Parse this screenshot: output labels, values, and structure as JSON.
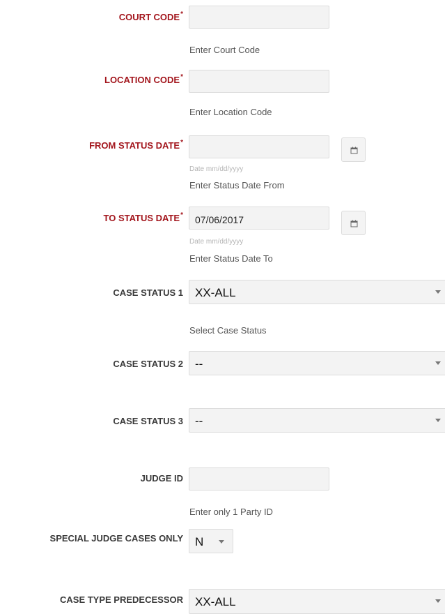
{
  "fields": {
    "court_code": {
      "label": "COURT CODE",
      "required_mark": "*",
      "value": "",
      "help": "Enter Court Code"
    },
    "location_code": {
      "label": "LOCATION CODE",
      "required_mark": "*",
      "value": "",
      "help": "Enter Location Code"
    },
    "from_status_date": {
      "label": "FROM STATUS DATE",
      "required_mark": "*",
      "value": "",
      "hint": "Date mm/dd/yyyy",
      "help": "Enter Status Date From",
      "icon": "calendar-icon"
    },
    "to_status_date": {
      "label": "TO STATUS DATE",
      "required_mark": "*",
      "value": "07/06/2017",
      "hint": "Date mm/dd/yyyy",
      "help": "Enter Status Date To",
      "icon": "calendar-icon"
    },
    "case_status_1": {
      "label": "CASE STATUS 1",
      "value": "XX-ALL",
      "help": "Select Case Status"
    },
    "case_status_2": {
      "label": "CASE STATUS 2",
      "value": "--"
    },
    "case_status_3": {
      "label": "CASE STATUS 3",
      "value": "--"
    },
    "judge_id": {
      "label": "JUDGE ID",
      "value": "",
      "help": "Enter only 1 Party ID"
    },
    "special_judge_cases_only": {
      "label": "SPECIAL JUDGE CASES ONLY",
      "value": "N"
    },
    "case_type_predecessor": {
      "label": "CASE TYPE PREDECESSOR",
      "value": "XX-ALL"
    }
  },
  "colors": {
    "required_label": "#a3161d",
    "label": "#3a3a3a",
    "field_bg": "#f3f3f3",
    "border": "#dcdcdc"
  }
}
